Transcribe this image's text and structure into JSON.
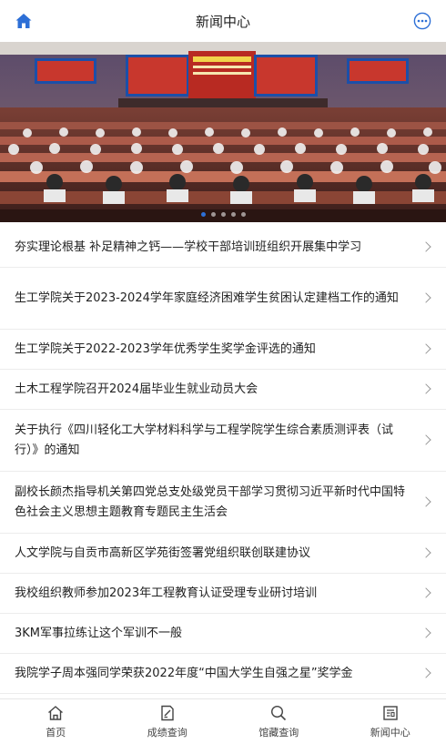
{
  "header": {
    "title": "新闻中心",
    "home_icon": "home-icon",
    "more_icon": "more-icon"
  },
  "banner": {
    "slides": 5,
    "active_slide": 1
  },
  "news": [
    {
      "title": "夯实理论根基 补足精神之钙——学校干部培训班组织开展集中学习"
    },
    {
      "title": "生工学院关于2023-2024学年家庭经济困难学生贫困认定建档工作的通知"
    },
    {
      "title": "生工学院关于2022-2023学年优秀学生奖学金评选的通知"
    },
    {
      "title": "土木工程学院召开2024届毕业生就业动员大会"
    },
    {
      "title": "关于执行《四川轻化工大学材料科学与工程学院学生综合素质测评表（试行）》的通知"
    },
    {
      "title": "副校长颜杰指导机关第四党总支处级党员干部学习贯彻习近平新时代中国特色社会主义思想主题教育专题民主生活会"
    },
    {
      "title": "人文学院与自贡市高新区学苑街签署党组织联创联建协议"
    },
    {
      "title": "我校组织教师参加2023年工程教育认证受理专业研讨培训"
    },
    {
      "title": "3KM军事拉练让这个军训不一般"
    },
    {
      "title": "我院学子周本强同学荣获2022年度“中国大学生自强之星”奖学金"
    }
  ],
  "tabbar": [
    {
      "label": "首页",
      "icon": "home-outline-icon"
    },
    {
      "label": "成绩查询",
      "icon": "document-edit-icon"
    },
    {
      "label": "馆藏查询",
      "icon": "search-icon"
    },
    {
      "label": "新闻中心",
      "icon": "news-icon"
    }
  ],
  "colors": {
    "accent": "#2d6fd6",
    "divider": "#ececec",
    "text": "#222222"
  }
}
